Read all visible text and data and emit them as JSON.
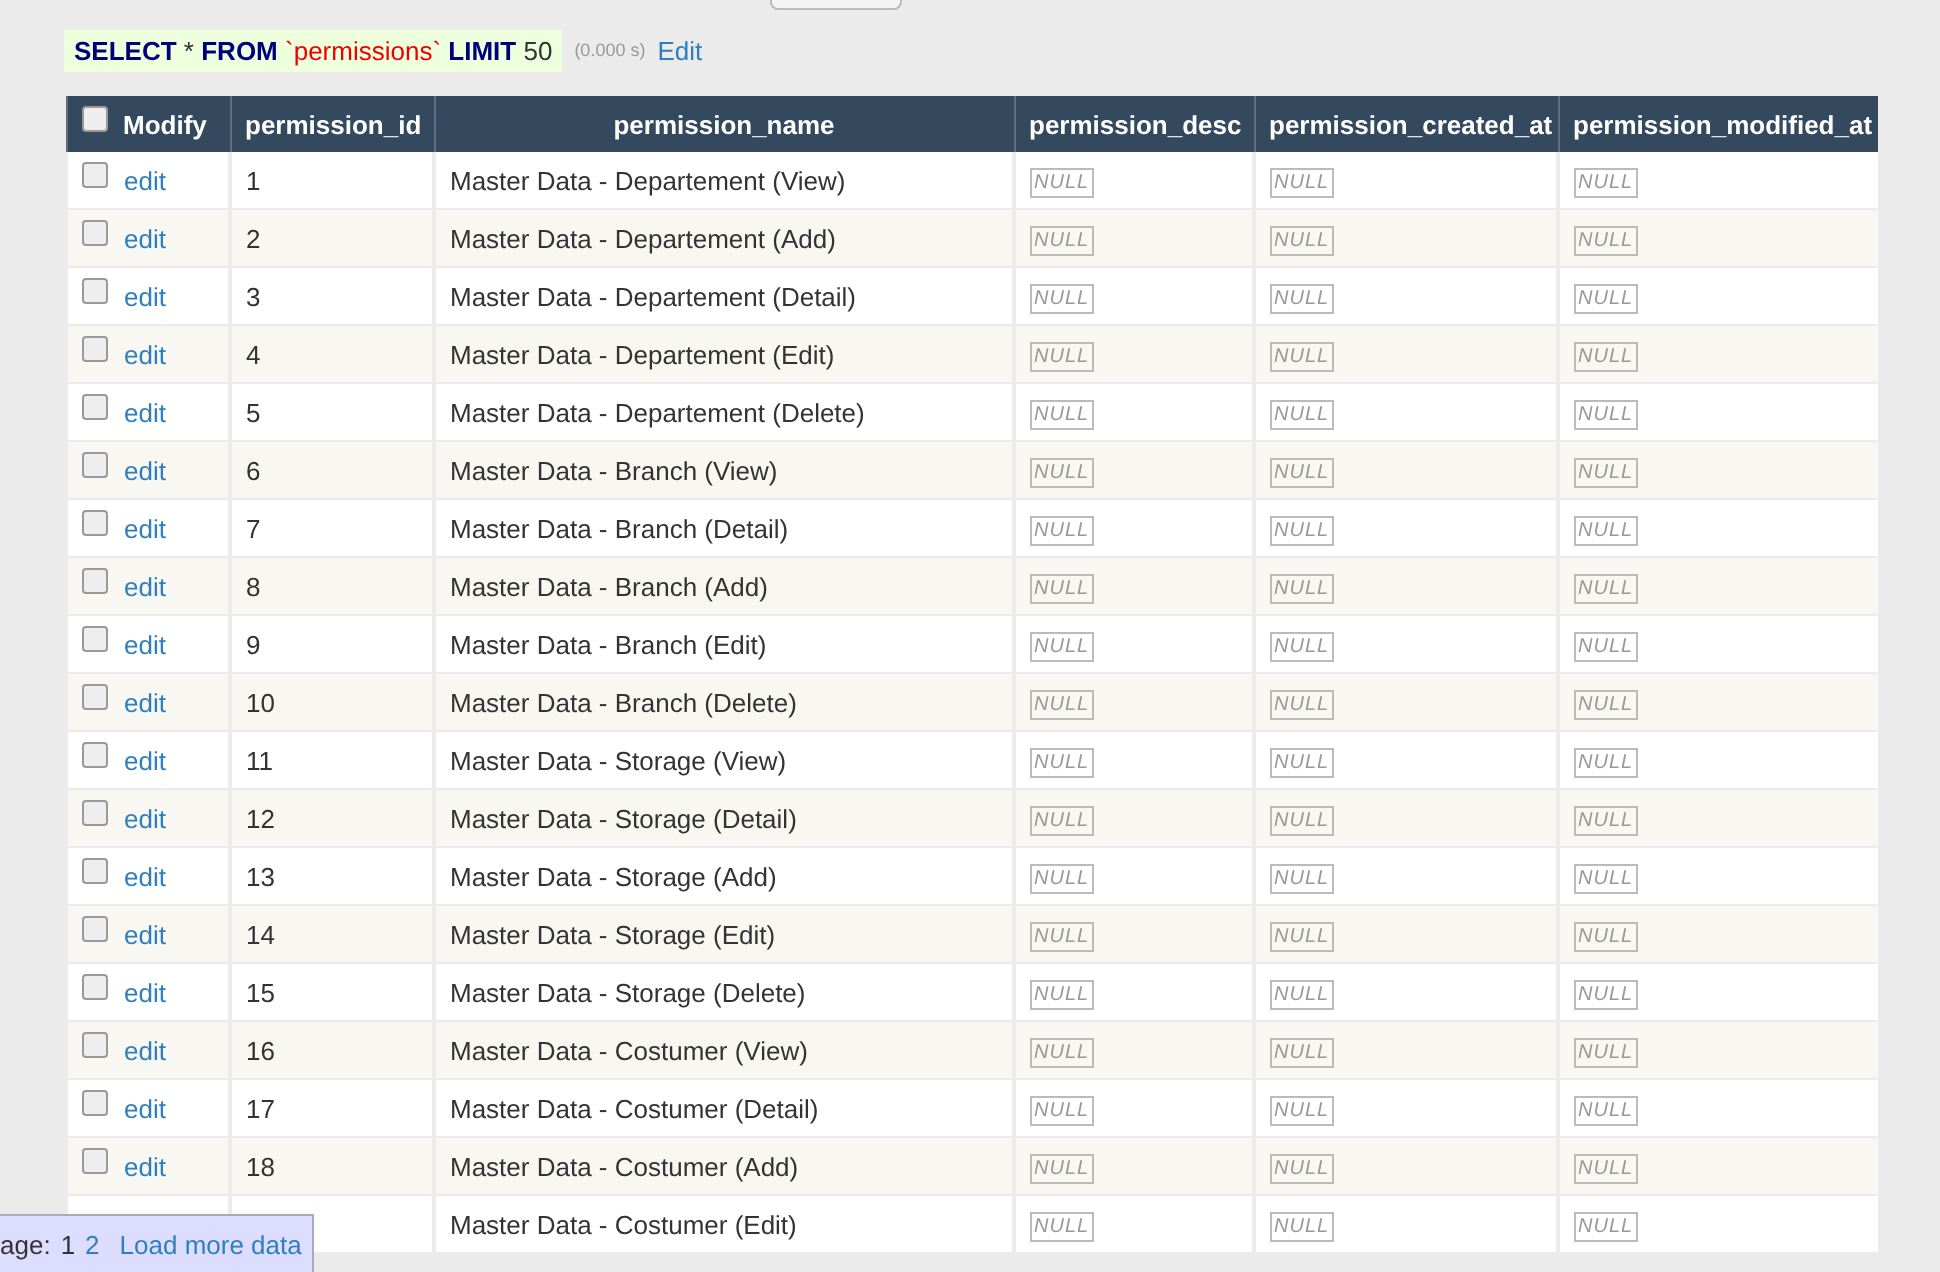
{
  "query": {
    "tokens": [
      {
        "kind": "keyword",
        "text": "SELECT"
      },
      {
        "kind": "plain",
        "text": "*"
      },
      {
        "kind": "keyword",
        "text": "FROM"
      },
      {
        "kind": "string",
        "text": "`permissions`"
      },
      {
        "kind": "keyword",
        "text": "LIMIT"
      },
      {
        "kind": "plain",
        "text": "50"
      }
    ],
    "time": "(0.000 s)",
    "edit_link": "Edit"
  },
  "table": {
    "select_all": {
      "checked": false
    },
    "columns": [
      "Modify",
      "permission_id",
      "permission_name",
      "permission_desc",
      "permission_created_at",
      "permission_modified_at"
    ],
    "rows": [
      {
        "checked": false,
        "action": "edit",
        "id": "1",
        "name": "Master Data - Departement (View)",
        "desc": "NULL",
        "created_at": "NULL",
        "modified_at": "NULL"
      },
      {
        "checked": false,
        "action": "edit",
        "id": "2",
        "name": "Master Data - Departement (Add)",
        "desc": "NULL",
        "created_at": "NULL",
        "modified_at": "NULL"
      },
      {
        "checked": false,
        "action": "edit",
        "id": "3",
        "name": "Master Data - Departement (Detail)",
        "desc": "NULL",
        "created_at": "NULL",
        "modified_at": "NULL"
      },
      {
        "checked": false,
        "action": "edit",
        "id": "4",
        "name": "Master Data - Departement (Edit)",
        "desc": "NULL",
        "created_at": "NULL",
        "modified_at": "NULL"
      },
      {
        "checked": false,
        "action": "edit",
        "id": "5",
        "name": "Master Data - Departement (Delete)",
        "desc": "NULL",
        "created_at": "NULL",
        "modified_at": "NULL"
      },
      {
        "checked": false,
        "action": "edit",
        "id": "6",
        "name": "Master Data - Branch (View)",
        "desc": "NULL",
        "created_at": "NULL",
        "modified_at": "NULL"
      },
      {
        "checked": false,
        "action": "edit",
        "id": "7",
        "name": "Master Data - Branch (Detail)",
        "desc": "NULL",
        "created_at": "NULL",
        "modified_at": "NULL"
      },
      {
        "checked": false,
        "action": "edit",
        "id": "8",
        "name": "Master Data - Branch (Add)",
        "desc": "NULL",
        "created_at": "NULL",
        "modified_at": "NULL"
      },
      {
        "checked": false,
        "action": "edit",
        "id": "9",
        "name": "Master Data - Branch (Edit)",
        "desc": "NULL",
        "created_at": "NULL",
        "modified_at": "NULL"
      },
      {
        "checked": false,
        "action": "edit",
        "id": "10",
        "name": "Master Data - Branch (Delete)",
        "desc": "NULL",
        "created_at": "NULL",
        "modified_at": "NULL"
      },
      {
        "checked": false,
        "action": "edit",
        "id": "11",
        "name": "Master Data - Storage (View)",
        "desc": "NULL",
        "created_at": "NULL",
        "modified_at": "NULL"
      },
      {
        "checked": false,
        "action": "edit",
        "id": "12",
        "name": "Master Data - Storage (Detail)",
        "desc": "NULL",
        "created_at": "NULL",
        "modified_at": "NULL"
      },
      {
        "checked": false,
        "action": "edit",
        "id": "13",
        "name": "Master Data - Storage (Add)",
        "desc": "NULL",
        "created_at": "NULL",
        "modified_at": "NULL"
      },
      {
        "checked": false,
        "action": "edit",
        "id": "14",
        "name": "Master Data - Storage (Edit)",
        "desc": "NULL",
        "created_at": "NULL",
        "modified_at": "NULL"
      },
      {
        "checked": false,
        "action": "edit",
        "id": "15",
        "name": "Master Data - Storage (Delete)",
        "desc": "NULL",
        "created_at": "NULL",
        "modified_at": "NULL"
      },
      {
        "checked": false,
        "action": "edit",
        "id": "16",
        "name": "Master Data - Costumer (View)",
        "desc": "NULL",
        "created_at": "NULL",
        "modified_at": "NULL"
      },
      {
        "checked": false,
        "action": "edit",
        "id": "17",
        "name": "Master Data - Costumer (Detail)",
        "desc": "NULL",
        "created_at": "NULL",
        "modified_at": "NULL"
      },
      {
        "checked": false,
        "action": "edit",
        "id": "18",
        "name": "Master Data - Costumer (Add)",
        "desc": "NULL",
        "created_at": "NULL",
        "modified_at": "NULL"
      },
      {
        "name": "Master Data - Costumer (Edit)",
        "desc": "NULL",
        "created_at": "NULL",
        "modified_at": "NULL"
      }
    ]
  },
  "pagination": {
    "label": "age:",
    "pages": [
      {
        "text": "1",
        "selected": true
      },
      {
        "text": "2",
        "selected": false
      }
    ],
    "load_more": "Load more data"
  }
}
